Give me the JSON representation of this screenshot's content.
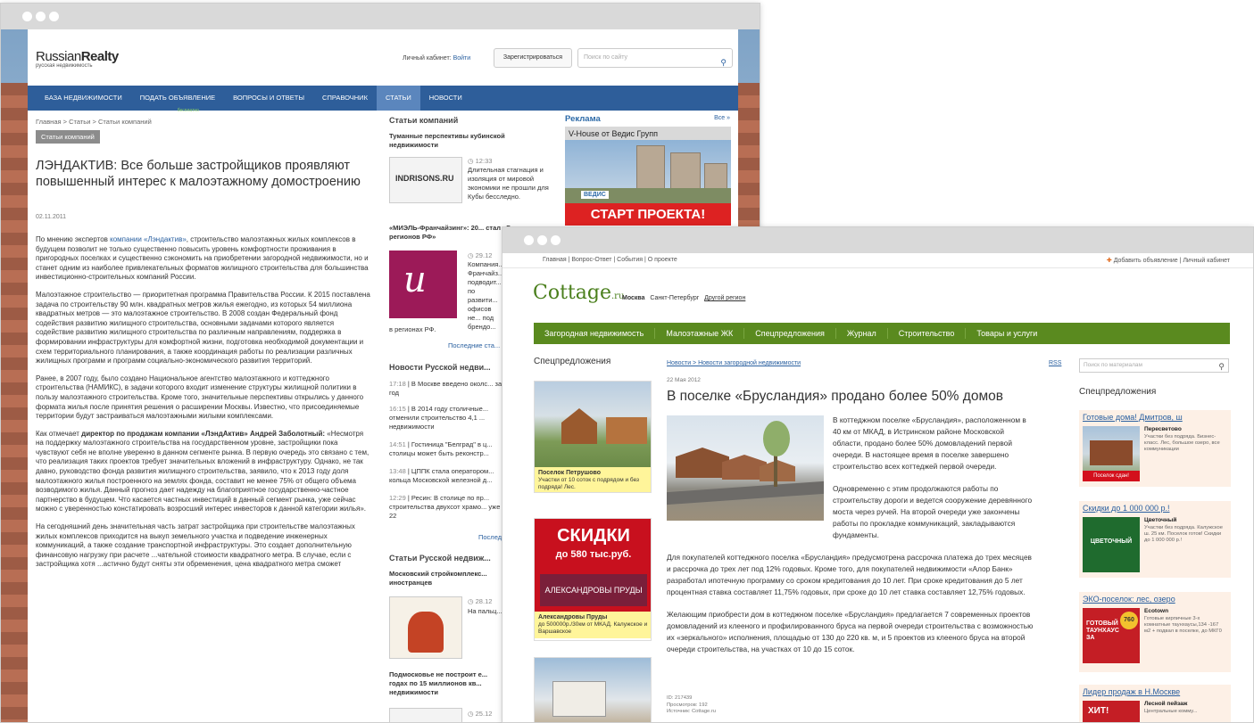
{
  "window1": {
    "site": {
      "logo_main": "Russian",
      "logo_bold": "Realty",
      "logo_tag": "русская недвижимость"
    },
    "account": {
      "label": "Личный кабинет:",
      "login": "Войти",
      "register": "Зарегистрироваться",
      "search_placeholder": "Поиск по сайту"
    },
    "nav": [
      {
        "label": "База недвижимости"
      },
      {
        "label": "Подать объявление",
        "badge": "бесплатно"
      },
      {
        "label": "Вопросы и ответы"
      },
      {
        "label": "Справочник"
      },
      {
        "label": "Статьи",
        "active": true
      },
      {
        "label": "Новости"
      }
    ],
    "breadcrumb": "Главная > Статьи > Статьи компаний",
    "category": "Статьи компаний",
    "title": "ЛЭНДАКТИВ: Все больше застройщиков проявляют повышенный интерес к малоэтажному домостроению",
    "date": "02.11.2011",
    "paragraphs": {
      "p1_pre": "По мнению экспертов ",
      "p1_link": "компании «Лэндактив»",
      "p1_post": ", строительство малоэтажных жилых комплексов в будущем позволит не только существенно повысить уровень комфортности проживания в пригородных поселках и существенно сэкономить на приобретении загородной недвижимости, но и станет одним из наиболее привлекательных форматов жилищного строительства для большинства инвестиционно-строительных компаний России.",
      "p2": "Малоэтажное строительство — приоритетная программа Правительства России. К 2015 поставлена задача по строительству 90 млн. квадратных метров жилья ежегодно, из которых 54 миллиона квадратных метров — это малоэтажное строительство. В 2008 создан Федеральный фонд содействия развитию жилищного строительства, основными задачами которого является содействие развитию жилищного строительства по различным направлениям, поддержка в формировании инфраструктуры для комфортной жизни, подготовка необходимой документации и схем территориального планирования, а также координация работы по реализации различных жилищных программ и программ социально-экономического развития территорий.",
      "p3": "Ранее, в 2007 году, было создано Национальное агентство малоэтажного и коттеджного строительства (НАМИКС), в задачи которого входит изменение структуры жилищной политики в пользу малоэтажного строительства. Кроме того, значительные перспективы открылись у данного формата жилья после принятия решения о расширении Москвы. Известно, что присоединяемые территории будут застраиваться малоэтажными жилыми комплексами.",
      "p4_pre": "Как отмечает ",
      "p4_bold": "директор по продажам компании «ЛэндАктив» Андрей Заболотный:",
      "p4_post": " «Несмотря на поддержку малоэтажного строительства на государственном уровне, застройщики пока чувствуют себя не вполне уверенно в данном сегменте рынка. В первую очередь это связано с тем, что реализация таких проектов требует значительных вложений в инфраструктуру. Однако, не так давно, руководство фонда развития жилищного строительства, заявило, что к 2013 году доля малоэтажного жилья построенного на землях фонда, составит не менее 75% от общего объема возводимого жилья. Данный прогноз дает надежду на благоприятное государственно-частное партнерство в будущем. Что касается частных инвестиций в данный сегмент рынка, уже сейчас можно с уверенностью констатировать возросший интерес инвесторов к данной категории жилья».",
      "p5": "На сегодняшний день значительная часть затрат застройщика при строительстве малоэтажных жилых комплексов приходится на выкуп земельного участка и подведение инженерных коммуникаций, а также создание транспортной инфраструктуры. Это создает дополнительную финансовую нагрузку при расчете ...чательной стоимости квадратного метра. В случае, если с застройщика хотя ...астично будут сняты эти обременения, цена квадратного метра сможет"
    },
    "middle": {
      "section1": "Статьи компаний",
      "a1_title": "Туманные перспективы кубинской недвижимости",
      "a1_logo": "INDRISONS.RU",
      "a1_time": "12:33",
      "a1_text": "Длительная стагнация и изоляция от мировой экономики не прошли для Кубы бесследно.",
      "a2_title": "«МИЭЛЬ-Франчайзинг»: 20... стал «Годом регионов РФ»",
      "a2_time": "29.12",
      "a2_text": "Компания... Франчайз... подводит... по развити... офисов не... под брендо...",
      "a2_tail": "в регионах РФ.",
      "more_link": "Последние ста...",
      "section2": "Новости Русской недви...",
      "news": [
        {
          "t": "17:18",
          "x": "В Москве введено околс... за год"
        },
        {
          "t": "16:15",
          "x": "В 2014 году столичные... отменили строительство 4,1 ... недвижимости"
        },
        {
          "t": "14:51",
          "x": "Гостиница \"Белград\" в ц... столицы может быть реконстр..."
        },
        {
          "t": "13:48",
          "x": "ЦППК стала оператором... кольца Московской железной д..."
        },
        {
          "t": "12:29",
          "x": "Ресин: В столице по пр... строительства двухсот храмо... уже 22"
        }
      ],
      "more_news": "Послед...",
      "section3": "Статьи Русской недвиж...",
      "a3_title": "Московский стройкомплекс... иностранцев",
      "a3_time": "28.12",
      "a3_text": "На пальц...",
      "a4_title": "Подмосковье не построит е... годах по 15 миллионов кв... недвижимости",
      "a4_time": "25.12"
    },
    "ads": {
      "title": "Реклама",
      "all": "Все »",
      "name": "V-House от Ведис Групп",
      "banner": "СТАРТ ПРОЕКТА!",
      "brand": "ВЕДИС"
    }
  },
  "window2": {
    "top_links": "Главная | Вопрос-Ответ | События | О проекте",
    "top_right": "Добавить объявление | Личный кабинет",
    "logo": "Cottage",
    "logo_suffix": ".ru",
    "regions": {
      "current": "Москва",
      "alt": "Санкт-Петербург",
      "other": "Другой регион"
    },
    "nav": [
      "Загородная недвижимость",
      "Малоэтажные ЖК",
      "Спецпредложения",
      "Журнал",
      "Строительство",
      "Товары и услуги"
    ],
    "left_title": "Спецпредложения",
    "promos": [
      {
        "name": "Поселок Петрушово",
        "text": "Участки от 10 соток с подрядом и без подряда! Лес."
      },
      {
        "name": "Александровы Пруды",
        "text": "до 500000р./30км от МКАД. Калужское и Варшавское",
        "banner": "СКИДКИ",
        "banner2": "до 580 тыс.руб.",
        "banner3": "АЛЕКСАНДРОВЫ ПРУДЫ"
      }
    ],
    "breadcrumb": "Новости > Новости загородной недвижимости",
    "rss": "RSS",
    "date": "22 Мая 2012",
    "title": "В поселке «Бруслandия» продано более 50% домов",
    "title_exact": "В поселке «Брусландия» продано более 50% домов",
    "p1": "В коттеджном поселке «Брусландия», расположенном в 40 км от МКАД, в Истринском районе Московской области, продано более 50% домовладений первой очереди. В настоящее время в поселке завершено строительство всех коттеджей первой очереди.",
    "p2": "Одновременно с этим продолжаются работы по строительству дороги и ведется сооружение деревянного моста через ручей. На второй очереди уже закончены работы по прокладке коммуникаций, закладываются фундаменты.",
    "p3": "Для покупателей коттеджного поселка «Брусландия» предусмотрена рассрочка платежа до трех месяцев и рассрочка до трех лет под 12% годовых. Кроме того, для покупателей недвижимости «Алор Банк» разработал ипотечную программу со сроком кредитования до 10 лет. При сроке кредитования до 5 лет процентная ставка составляет 11,75% годовых, при сроке до 10 лет ставка составляет 12,75% годовых.",
    "p4": "Желающим приобрести дом в коттеджном поселке «Брусландия» предлагается 7 современных проектов домовладений из клееного и профилированного бруса на первой очереди строительства с возможностью их «зеркального» исполнения, площадью от 130 до 220 кв. м, и 5 проектов из клееного бруса на второй очереди строительства, на участках от 10 до 15 соток.",
    "meta": [
      "ID: 217439",
      "Просмотров: 192",
      "Источник: Cottage.ru"
    ],
    "search_placeholder": "Поиск по материалам",
    "right_title": "Спецпредложения",
    "cards": [
      {
        "title": "Готовые дома! Дмитров, ш",
        "name": "Пересветово",
        "text": "Участки без подряда. Бизнес-класс. Лес, большое озеро, все коммуникации",
        "badge": "Поселок сдан!"
      },
      {
        "title": "Скидки до 1 000 000 р.!",
        "name": "Цветочный",
        "text": "Участки без подряда. Калужское ш. 25 км. Поселок готов! Скидки до 1 000 000 р.!",
        "badge": "ЦВЕТОЧНЫЙ"
      },
      {
        "title": "ЭКО-поселок: лес, озеро",
        "name": "Ecotown",
        "text": "Готовые кирпичные 3-х комнатные таунхаусы,134 -167 м2 + подвал в поселке, до МКГ0",
        "badge": "ГОТОВЫЙ ТАУНХАУС ЗА",
        "badge2": "760"
      },
      {
        "title": "Лидер продаж в Н.Москве",
        "name": "Лесной пейзаж",
        "text": "Центральные комму...",
        "badge": "ХИТ!"
      }
    ]
  }
}
